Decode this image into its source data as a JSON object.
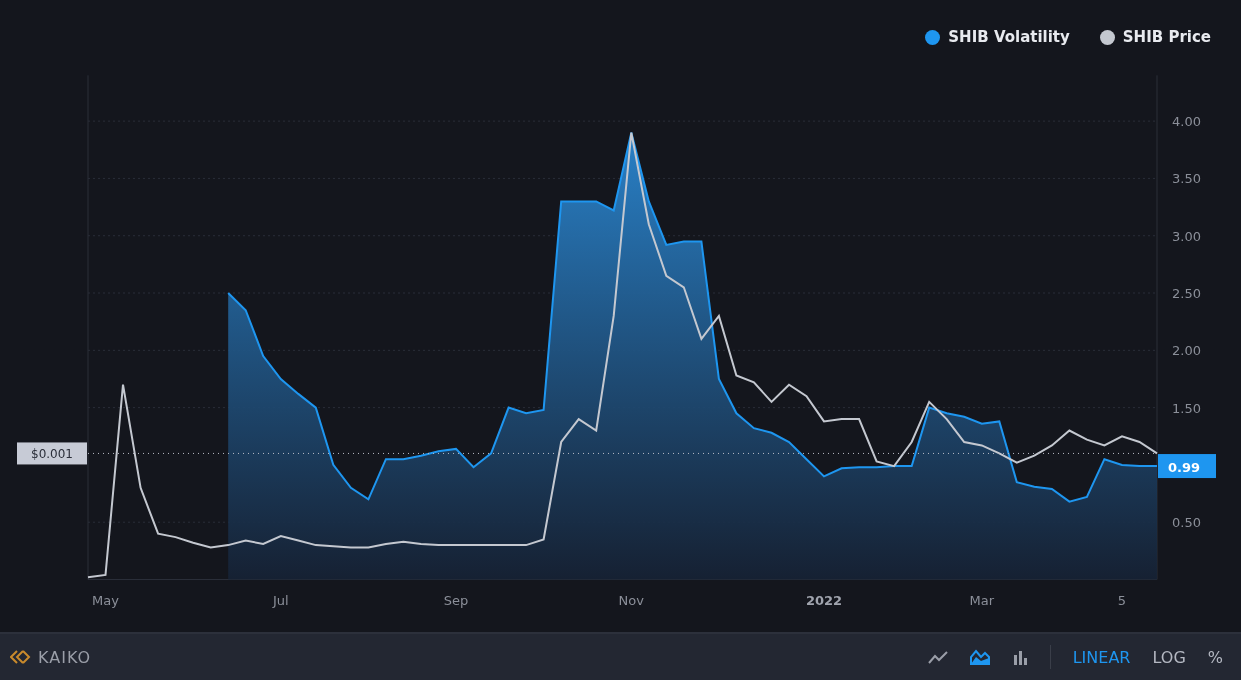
{
  "chart": {
    "price_label": "$0.001",
    "last_value": "0.99",
    "chart_data": {
      "type": "area",
      "ylim": [
        0,
        4.4
      ],
      "grid": true,
      "ref_lines": [
        {
          "axis": "y",
          "value": 1.1
        }
      ],
      "categories": [
        null,
        "May",
        null,
        null,
        null,
        null,
        null,
        null,
        null,
        null,
        null,
        "Jul",
        null,
        null,
        null,
        null,
        null,
        null,
        null,
        null,
        null,
        "Sep",
        null,
        null,
        null,
        null,
        null,
        null,
        null,
        null,
        null,
        "Nov",
        null,
        null,
        null,
        null,
        null,
        null,
        null,
        null,
        null,
        null,
        "2022",
        null,
        null,
        null,
        null,
        null,
        null,
        null,
        null,
        "Mar",
        null,
        null,
        null,
        null,
        null,
        null,
        null,
        "5",
        null,
        null
      ],
      "yticks": [
        {
          "value": 0.5,
          "label": "0.50"
        },
        {
          "value": 1.5,
          "label": "1.50"
        },
        {
          "value": 2,
          "label": "2.00"
        },
        {
          "value": 2.5,
          "label": "2.50"
        },
        {
          "value": 3,
          "label": "3.00"
        },
        {
          "value": 3.5,
          "label": "3.50"
        },
        {
          "value": 4,
          "label": "4.00"
        }
      ],
      "series": [
        {
          "name": "SHIB Volatility",
          "type": "area",
          "color": "#1e96f0",
          "values": [
            null,
            null,
            null,
            null,
            null,
            null,
            null,
            null,
            2.5,
            2.35,
            1.95,
            1.75,
            1.62,
            1.5,
            1.0,
            0.8,
            0.7,
            1.05,
            1.05,
            1.08,
            1.12,
            1.14,
            0.98,
            1.1,
            1.5,
            1.45,
            1.48,
            3.3,
            3.3,
            3.3,
            3.22,
            3.9,
            3.3,
            2.92,
            2.95,
            2.95,
            1.75,
            1.45,
            1.32,
            1.28,
            1.2,
            1.05,
            0.9,
            0.97,
            0.98,
            0.98,
            0.99,
            0.99,
            1.5,
            1.45,
            1.42,
            1.36,
            1.38,
            0.85,
            0.81,
            0.79,
            0.68,
            0.72,
            1.05,
            1.0,
            0.99,
            0.99
          ]
        },
        {
          "name": "SHIB Price",
          "type": "line",
          "color": "#c4c8d0",
          "values": [
            0.02,
            0.04,
            1.7,
            0.8,
            0.4,
            0.37,
            0.32,
            0.28,
            0.3,
            0.34,
            0.31,
            0.38,
            0.34,
            0.3,
            0.29,
            0.28,
            0.28,
            0.31,
            0.33,
            0.31,
            0.3,
            0.3,
            0.3,
            0.3,
            0.3,
            0.3,
            0.35,
            1.2,
            1.4,
            1.3,
            2.3,
            3.9,
            3.1,
            2.65,
            2.55,
            2.1,
            2.3,
            1.78,
            1.72,
            1.55,
            1.7,
            1.6,
            1.38,
            1.4,
            1.4,
            1.03,
            0.99,
            1.2,
            1.55,
            1.4,
            1.2,
            1.17,
            1.1,
            1.02,
            1.08,
            1.17,
            1.3,
            1.22,
            1.17,
            1.25,
            1.2,
            1.1
          ]
        }
      ]
    }
  },
  "footer": {
    "source": "KAIKO",
    "chart_types": [
      {
        "kind": "line",
        "selected": false
      },
      {
        "kind": "area",
        "selected": true
      },
      {
        "kind": "bars",
        "selected": false
      }
    ],
    "scales": [
      {
        "label": "LINEAR",
        "selected": true
      },
      {
        "label": "LOG",
        "selected": false
      },
      {
        "label": "%",
        "selected": false
      }
    ]
  }
}
